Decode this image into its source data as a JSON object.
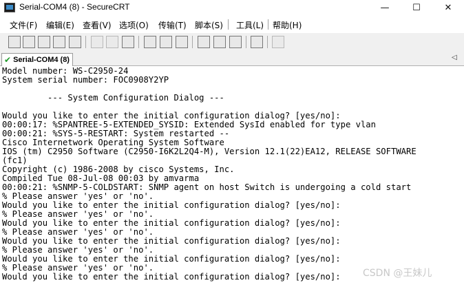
{
  "window": {
    "title": "Serial-COM4 (8) - SecureCRT",
    "icon": "securecrt-app-icon",
    "minimize": "—",
    "maximize": "☐",
    "close": "✕"
  },
  "menu": [
    "文件(F)",
    "编辑(E)",
    "查看(V)",
    "选项(O)",
    "传输(T)",
    "脚本(S)",
    "工具(L)",
    "帮助(H)"
  ],
  "toolbar": {
    "icons": [
      "connect-icon",
      "quick-connect-icon",
      "connect-tab-icon",
      "reconnect-icon",
      "disconnect-icon",
      "copy-icon",
      "paste-icon",
      "find-icon",
      "print-icon",
      "print-setup-icon",
      "print-selection-icon",
      "session-options-icon",
      "global-options-icon",
      "keymap-icon",
      "help-icon",
      "about-icon"
    ]
  },
  "tab": {
    "status_glyph": "✔",
    "label": "Serial-COM4 (8)",
    "scroll_left": "◁"
  },
  "terminal": {
    "lines": [
      "Model number: WS-C2950-24",
      "System serial number: FOC0908Y2YP",
      "",
      "         --- System Configuration Dialog ---",
      "",
      "Would you like to enter the initial configuration dialog? [yes/no]:",
      "00:00:17: %SPANTREE-5-EXTENDED_SYSID: Extended SysId enabled for type vlan",
      "00:00:21: %SYS-5-RESTART: System restarted --",
      "Cisco Internetwork Operating System Software",
      "IOS (tm) C2950 Software (C2950-I6K2L2Q4-M), Version 12.1(22)EA12, RELEASE SOFTWARE",
      "(fc1)",
      "Copyright (c) 1986-2008 by cisco Systems, Inc.",
      "Compiled Tue 08-Jul-08 00:03 by amvarma",
      "00:00:21: %SNMP-5-COLDSTART: SNMP agent on host Switch is undergoing a cold start",
      "% Please answer 'yes' or 'no'.",
      "Would you like to enter the initial configuration dialog? [yes/no]:",
      "% Please answer 'yes' or 'no'.",
      "Would you like to enter the initial configuration dialog? [yes/no]:",
      "% Please answer 'yes' or 'no'.",
      "Would you like to enter the initial configuration dialog? [yes/no]:",
      "% Please answer 'yes' or 'no'.",
      "Would you like to enter the initial configuration dialog? [yes/no]:",
      "% Please answer 'yes' or 'no'.",
      "Would you like to enter the initial configuration dialog? [yes/no]:"
    ]
  },
  "watermark": "CSDN @王妹儿"
}
